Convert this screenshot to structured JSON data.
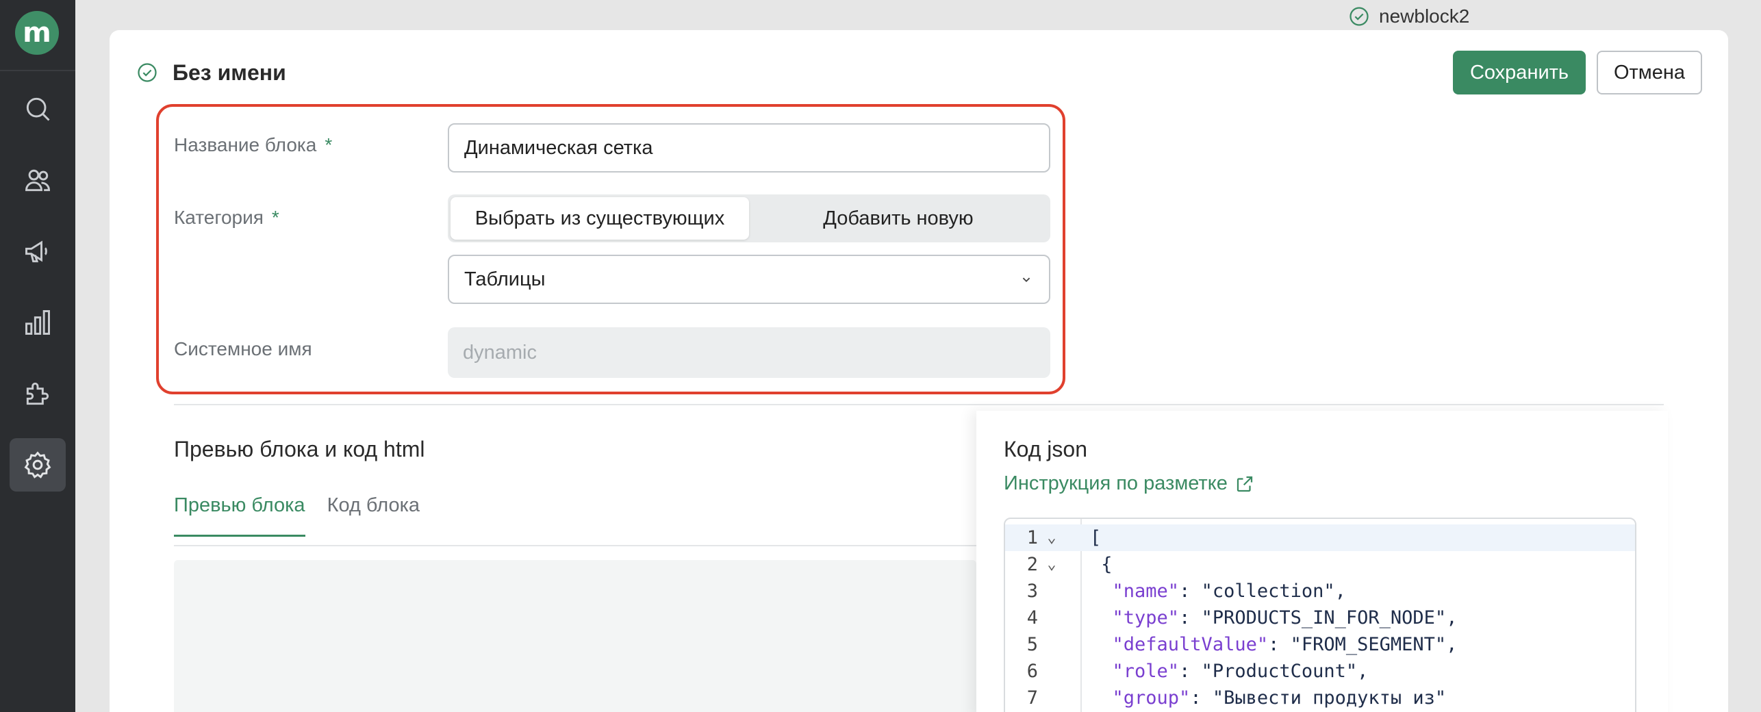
{
  "sidebar": {
    "logo_letter": "m",
    "items": [
      {
        "icon": "search-icon"
      },
      {
        "icon": "users-icon"
      },
      {
        "icon": "megaphone-icon"
      },
      {
        "icon": "analytics-icon"
      },
      {
        "icon": "puzzle-icon"
      },
      {
        "icon": "settings-icon",
        "active": true
      }
    ]
  },
  "top_status": {
    "label": "newblock2"
  },
  "header": {
    "title": "Без имени",
    "save_label": "Сохранить",
    "cancel_label": "Отмена"
  },
  "form": {
    "block_name_label": "Название блока",
    "block_name_value": "Динамическая сетка",
    "category_label": "Категория",
    "required_mark": "*",
    "segment_existing": "Выбрать из существующих",
    "segment_new": "Добавить новую",
    "category_value": "Таблицы",
    "system_name_label": "Системное имя",
    "system_name_value": "dynamic"
  },
  "preview": {
    "title": "Превью блока и код html",
    "tab_preview": "Превью блока",
    "tab_code": "Код блока"
  },
  "json_section": {
    "title": "Код json",
    "instruction_link": "Инструкция по разметке",
    "lines": [
      {
        "n": "1",
        "fold": true,
        "text": "["
      },
      {
        "n": "2",
        "fold": true,
        "text": " {"
      },
      {
        "n": "3",
        "key": "\"name\"",
        "val": ": \"collection\","
      },
      {
        "n": "4",
        "key": "\"type\"",
        "val": ": \"PRODUCTS_IN_FOR_NODE\","
      },
      {
        "n": "5",
        "key": "\"defaultValue\"",
        "val": ": \"FROM_SEGMENT\","
      },
      {
        "n": "6",
        "key": "\"role\"",
        "val": ": \"ProductCount\","
      },
      {
        "n": "7",
        "key": "\"group\"",
        "val": ": \"Вывести продукты из\""
      }
    ]
  },
  "colors": {
    "accent": "#3a8a62",
    "highlight": "#e0402e",
    "sidebar": "#2b2d30"
  }
}
